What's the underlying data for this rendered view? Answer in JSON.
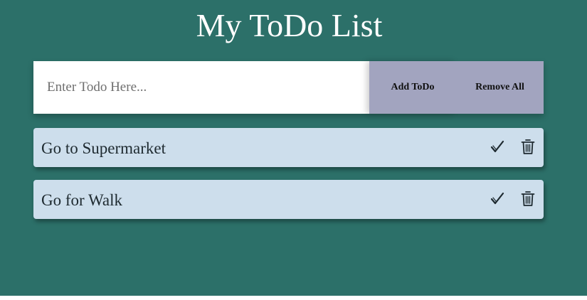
{
  "app": {
    "title": "My ToDo List"
  },
  "form": {
    "placeholder": "Enter Todo Here...",
    "value": "",
    "add_label": "Add ToDo",
    "remove_all_label": "Remove All"
  },
  "todos": [
    {
      "text": "Go to Supermarket",
      "done_icon": "check-icon",
      "delete_icon": "trash-icon"
    },
    {
      "text": "Go for Walk",
      "done_icon": "check-icon",
      "delete_icon": "trash-icon"
    }
  ],
  "colors": {
    "background": "#2c7069",
    "item_background": "#cddeec",
    "button_background": "#a2a4bf",
    "title_text": "#ffffff"
  }
}
